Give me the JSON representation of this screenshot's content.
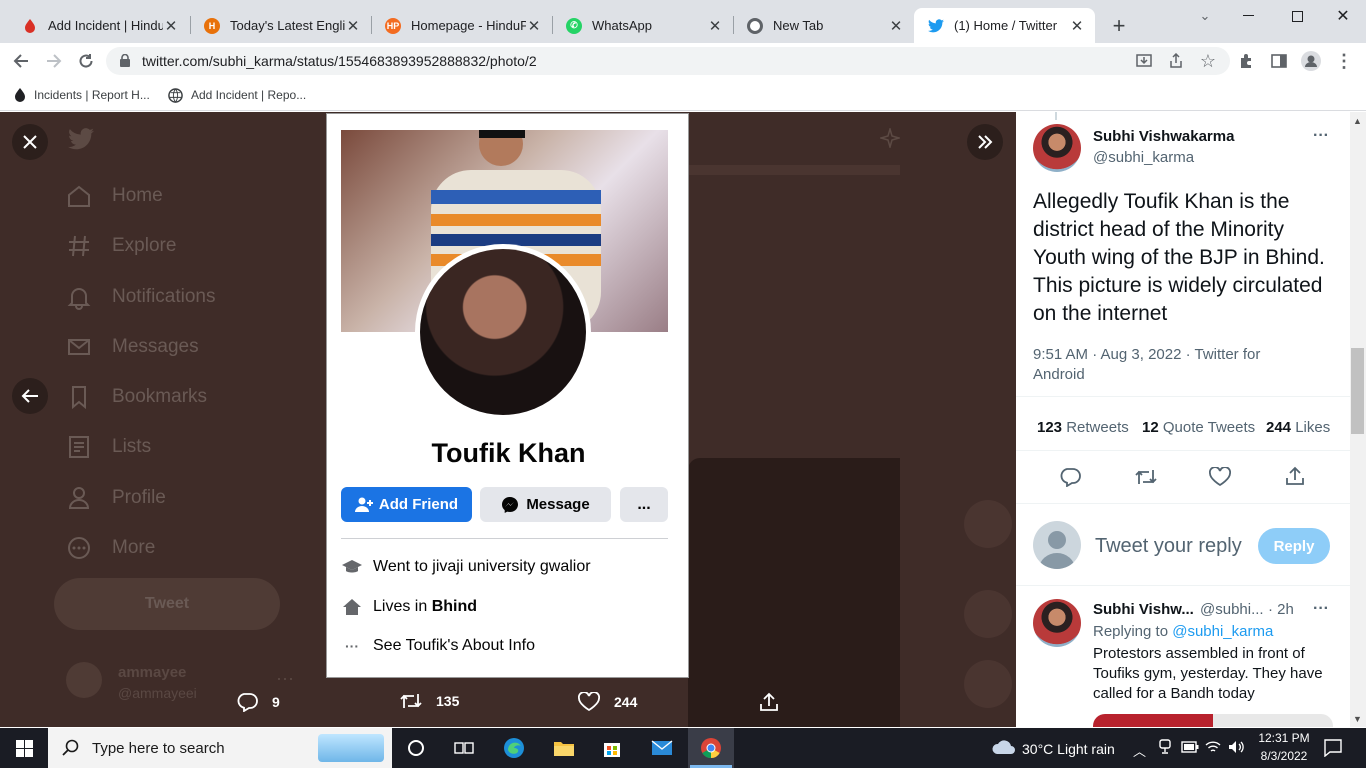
{
  "tabs": [
    {
      "title": "Add Incident | HinduDa",
      "favicon": "hindudb-icon",
      "color": "#d93025"
    },
    {
      "title": "Today's Latest English N",
      "favicon": "news-icon",
      "color": "#e8710a"
    },
    {
      "title": "Homepage - HinduPost",
      "favicon": "hindupost-icon",
      "color": "#f36c21"
    },
    {
      "title": "WhatsApp",
      "favicon": "whatsapp-icon",
      "color": "#25d366"
    },
    {
      "title": "New Tab",
      "favicon": "chrome-icon",
      "color": "#5f6368"
    },
    {
      "title": "(1) Home / Twitter",
      "favicon": "twitter-icon",
      "color": "#1d9bf0"
    }
  ],
  "address": {
    "url": "twitter.com/subhi_karma/status/1554683893952888832/photo/2"
  },
  "bookmarks": [
    {
      "label": "Incidents | Report H..."
    },
    {
      "label": "Add Incident | Repo..."
    }
  ],
  "twitter_nav": [
    "Home",
    "Explore",
    "Notifications",
    "Messages",
    "Bookmarks",
    "Lists",
    "Profile",
    "More"
  ],
  "tweet_button": "Tweet",
  "account": {
    "name": "ammayee",
    "handle": "@ammayeei"
  },
  "photo": {
    "name": "Toufik Khan",
    "add_friend": "Add Friend",
    "message": "Message",
    "more": "...",
    "education": "Went to jivaji university gwalior",
    "lives_prefix": "Lives in ",
    "lives_city": "Bhind",
    "about": "See Toufik's About Info"
  },
  "actions": {
    "replies": "9",
    "retweets": "135",
    "likes": "244"
  },
  "tweet": {
    "author_name": "Subhi Vishwakarma",
    "author_handle": "@subhi_karma",
    "text": "Allegedly Toufik Khan is the district head of the Minority Youth wing of the BJP in Bhind. This picture is widely circulated on the internet",
    "time": "9:51 AM · Aug 3, 2022 · Twitter for Android",
    "retweets": "123",
    "retweets_label": "Retweets",
    "quotes": "12",
    "quotes_label": "Quote Tweets",
    "likes": "244",
    "likes_label": "Likes"
  },
  "reply_box": {
    "placeholder": "Tweet your reply",
    "button": "Reply"
  },
  "reply": {
    "author_name": "Subhi Vishw...",
    "author_handle": "@subhi...",
    "time": "· 2h",
    "replying_prefix": "Replying to ",
    "replying_to": "@subhi_karma",
    "text": "Protestors assembled in front of Toufiks gym, yesterday. They have called for a Bandh today"
  },
  "taskbar": {
    "search_placeholder": "Type here to search",
    "weather": "30°C  Light rain",
    "time": "12:31 PM",
    "date": "8/3/2022"
  },
  "colors": {
    "twitter_blue": "#1d9bf0",
    "facebook_blue": "#1b74e4",
    "overlay": "#3f2c28"
  }
}
